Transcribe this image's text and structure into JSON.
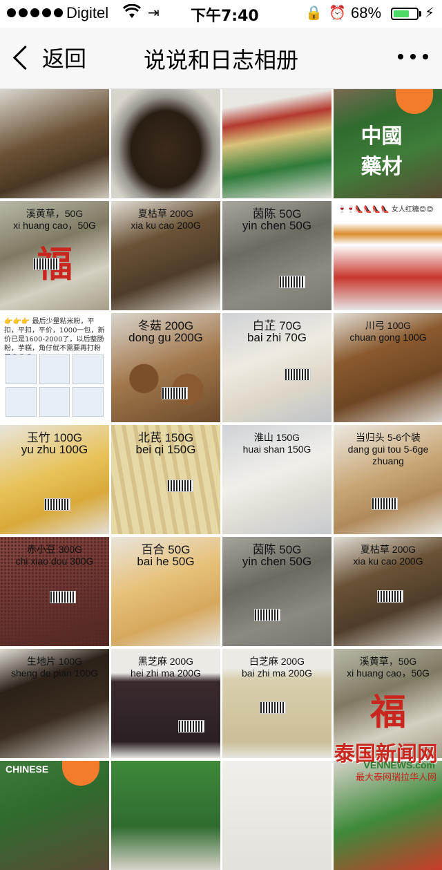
{
  "status_bar": {
    "carrier": "Digitel",
    "time": "下午7:40",
    "battery": "68%",
    "battery_level": 0.68
  },
  "nav": {
    "back_label": "返回",
    "title": "说说和日志相册"
  },
  "photos": [
    {
      "caption": "",
      "bg": "linear-gradient(160deg,#d9d6cf,#6b5235 45%,#4a3722 70%,#cfc9be)"
    },
    {
      "caption": "",
      "bg": "radial-gradient(ellipse at 50% 55%,#3a2a1c 0%,#2a1e14 45%,#9a9690 62%,#d8d4cc 80%)"
    },
    {
      "caption": "",
      "bg": "linear-gradient(170deg,#e9e7e2 0%,#e9e7e2 15%,#b33a2f 30%,#d9c27a 45%,#2f7b3a 70%,#e0ded8 100%)"
    },
    {
      "caption": "",
      "bg": "linear-gradient(160deg,#7a6a52,#2f6b2f 30%,#3f7d39 60%,#5a4a34)",
      "hanzi": "中國藥材",
      "hanzi_color": "#ffffff",
      "sticker": true
    },
    {
      "caption": "溪黄草，50G\nxi huang cao，50G",
      "bg": "linear-gradient(160deg,#b9b7a8,#7f7a62 40%,#d4d0c2 70%,#a59f88)",
      "hanzi": "福"
    },
    {
      "caption": "夏枯草 200G\nxia ku cao 200G",
      "bg": "linear-gradient(160deg,#e2ded6,#6a5236 35%,#4f3d29 65%,#d9d5cd)"
    },
    {
      "caption": "茵陈 50G\nyin chen 50G",
      "caption_big": true,
      "bg": "linear-gradient(160deg,#a9a69e,#6d6a62 40%,#8d8a82 70%,#7b7870)"
    },
    {
      "caption": "",
      "chat": "🍷🍷👠👠👠👠 女人红糖😊😊",
      "bg": "linear-gradient(180deg,#ffffff 0%,#ffffff 20%,#d98c2c 30%,#ffffff 40%,#c7382d 70%,#e6e6e6 100%)"
    },
    {
      "caption": "",
      "chat": "👉👉👉 最后少量粘米粉，平扣，平扣，平价，1000一包，新价已是1600-2000了，以后整肠粉，芋糕，角仔就不需要再打粉了😄😄😄",
      "packs": true,
      "bg": "#ffffff"
    },
    {
      "caption": "冬菇 200G\ndong gu 200G",
      "caption_big": true,
      "bg": "radial-gradient(circle at 30% 60%,#7a4f2a 0,#7a4f2a 14%,transparent 15%),radial-gradient(circle at 70% 70%,#8a5a30 0,#8a5a30 14%,transparent 15%),linear-gradient(160deg,#d9d5cd,#a3784c 50%,#6b4a2a)"
    },
    {
      "caption": "白芷 70G\nbai zhi 70G",
      "caption_big": true,
      "bg": "linear-gradient(160deg,#cfd2d6,#efeae0 40%,#dcd6c8 70%,#bfc4ca)"
    },
    {
      "caption": "川弓 100G\nchuan gong 100G",
      "bg": "linear-gradient(160deg,#e4e0d8,#8a5a2e 35%,#6f4623 65%,#d6d2ca)"
    },
    {
      "caption": "玉竹 100G\nyu zhu 100G",
      "caption_big": true,
      "bg": "linear-gradient(160deg,#e7e4dc,#e8c35a 45%,#d9a93a 70%,#e2ded6)"
    },
    {
      "caption": "北芪 150G\nbei qi 150G",
      "caption_big": true,
      "bg": "repeating-linear-gradient(80deg,#e6d9a6 0 10px,#d6c28a 10px 16px),#e0d7b8"
    },
    {
      "caption": "淮山 150G\nhuai shan 150G",
      "bg": "linear-gradient(160deg,#cfd3d8,#f1efe9 45%,#dedbd3 70%,#c6cad0)"
    },
    {
      "caption": "当归头 5-6个装\ndang gui tou 5-6ge zhuang",
      "bg": "linear-gradient(160deg,#ece9e2,#c9a878 45%,#b08a5a 70%,#e6e3dc)"
    },
    {
      "caption": "赤小豆 300G\nchi xiao dou 300G",
      "bg": "radial-gradient(#5c2a26 1.5px,transparent 2px) 0 0/5px 5px,linear-gradient(160deg,#8a4a44,#4e2420)"
    },
    {
      "caption": "百合 50G\nbai he 50G",
      "caption_big": true,
      "bg": "linear-gradient(160deg,#e8e4db,#e7c27c 40%,#d6a85e 70%,#e5e1d8)"
    },
    {
      "caption": "茵陈 50G\nyin chen 50G",
      "caption_big": true,
      "bg": "linear-gradient(160deg,#a7a49c,#6c6961 40%,#8b8880 70%,#797670)"
    },
    {
      "caption": "夏枯草 200G\nxia ku cao 200G",
      "bg": "linear-gradient(160deg,#e2ded6,#6a5236 35%,#4f3d29 65%,#d9d5cd)"
    },
    {
      "caption": "生地片 100G\nsheng de pian 100G",
      "bg": "linear-gradient(160deg,#e1ddd5,#2b2118 30%,#3a2c20 60%,#d8d4cc)"
    },
    {
      "caption": "黑芝麻 200G\nhei zhi ma 200G",
      "bg": "linear-gradient(180deg,#eceae5 0%,#eceae5 22%,#3a2a2e 30%,#2a1f24 85%,#e6e4df 100%)"
    },
    {
      "caption": "白芝麻 200G\nbai zhi ma 200G",
      "bg": "linear-gradient(180deg,#eceae5 0%,#eceae5 18%,#d9cfae 28%,#cbbf98 85%,#e6e4df 100%)"
    },
    {
      "caption": "溪黄草，50G\nxi huang cao，50G",
      "bg": "linear-gradient(160deg,#b9b7a8,#7f7a62 40%,#d4d0c2 70%,#a59f88)",
      "hanzi": "福"
    },
    {
      "caption": "",
      "label": "CHINESE",
      "sticker": true,
      "bg": "linear-gradient(160deg,#3d7a3a,#2f6b2f 40%,#5a4a34)"
    },
    {
      "caption": "",
      "bg": "linear-gradient(180deg,#3e8a3a,#2f6b2f 60%,#d7d3ca)"
    },
    {
      "caption": "",
      "bg": "linear-gradient(180deg,#f0efea,#e3e1db)"
    },
    {
      "caption": "",
      "bg": "linear-gradient(160deg,#d7d3ca,#3e8a3a 50%,#c93a2a)"
    }
  ],
  "watermark": {
    "title": "泰国新闻网",
    "url": "VENNEWS.com",
    "sub": "最大泰网瑞拉华人网"
  }
}
